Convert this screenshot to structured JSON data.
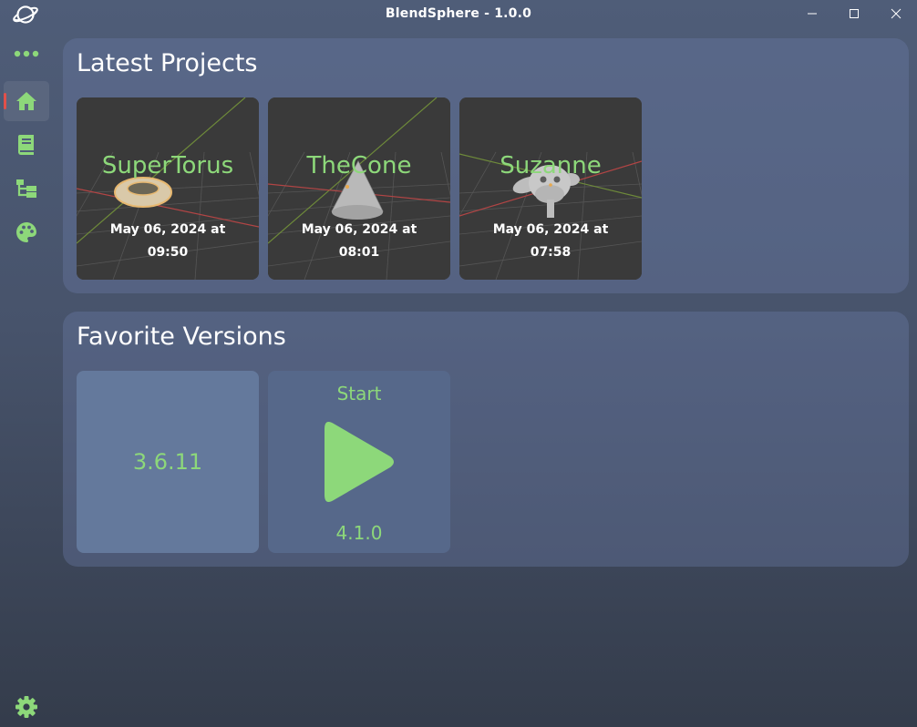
{
  "window": {
    "title": "BlendSphere - 1.0.0"
  },
  "sidebar": {
    "items": [
      {
        "name": "more",
        "icon": "more-dots-icon"
      },
      {
        "name": "home",
        "icon": "home-icon",
        "active": true
      },
      {
        "name": "library",
        "icon": "book-icon"
      },
      {
        "name": "versions",
        "icon": "tree-icon"
      },
      {
        "name": "themes",
        "icon": "palette-icon"
      }
    ],
    "settings_icon": "gear-icon"
  },
  "latest_projects": {
    "title": "Latest Projects",
    "projects": [
      {
        "name": "SuperTorus",
        "date_line1": "May 06, 2024 at",
        "date_line2": "09:50"
      },
      {
        "name": "TheCone",
        "date_line1": "May 06, 2024 at",
        "date_line2": "08:01"
      },
      {
        "name": "Suzanne",
        "date_line1": "May 06, 2024 at",
        "date_line2": "07:58"
      }
    ]
  },
  "favorite_versions": {
    "title": "Favorite Versions",
    "versions": [
      {
        "label": "3.6.11"
      },
      {
        "start_label": "Start",
        "label": "4.1.0"
      }
    ]
  },
  "colors": {
    "accent": "#8dd87a",
    "active_marker": "#e2504a"
  }
}
